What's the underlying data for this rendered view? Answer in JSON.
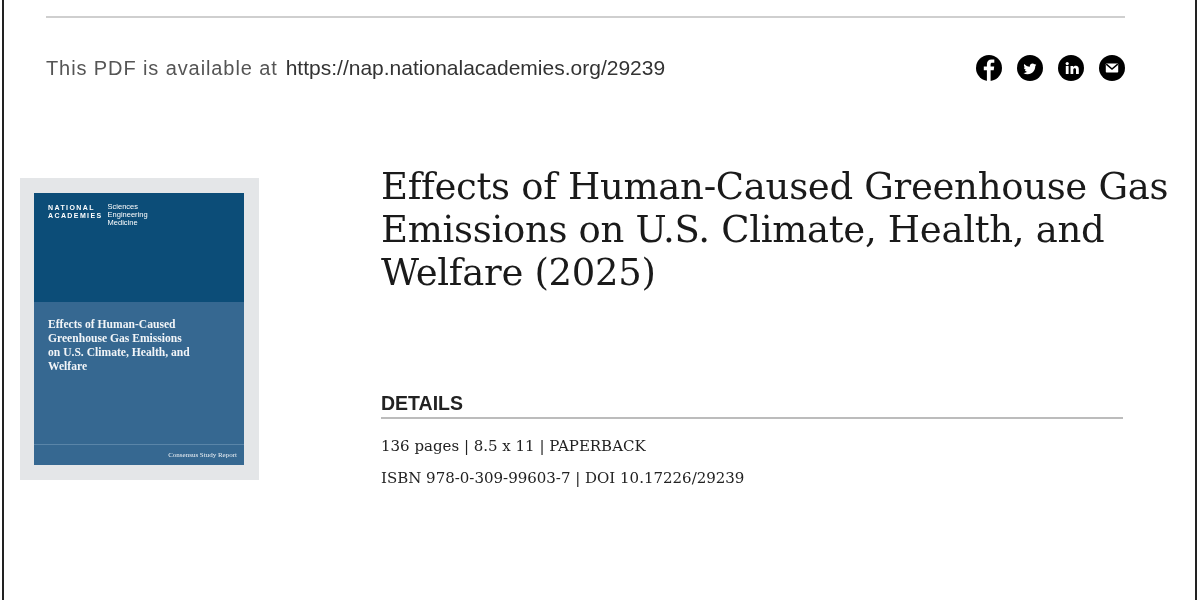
{
  "header": {
    "availability_text": "This PDF is available at",
    "url": "https://nap.nationalacademies.org/29239"
  },
  "cover": {
    "logo_name": "NATIONAL ACADEMIES",
    "logo_divisions": "Sciences Engineering Medicine",
    "title": "Effects of Human-Caused Greenhouse Gas Emissions on U.S. Climate, Health, and Welfare",
    "series": "Consensus Study Report"
  },
  "title": "Effects of Human-Caused Greenhouse Gas Emissions on U.S. Climate, Health, and Welfare (2025)",
  "details": {
    "heading": "DETAILS",
    "lines": [
      "136 pages | 8.5 x 11 | PAPERBACK",
      "ISBN 978-0-309-99603-7 | DOI 10.17226/29239"
    ]
  }
}
